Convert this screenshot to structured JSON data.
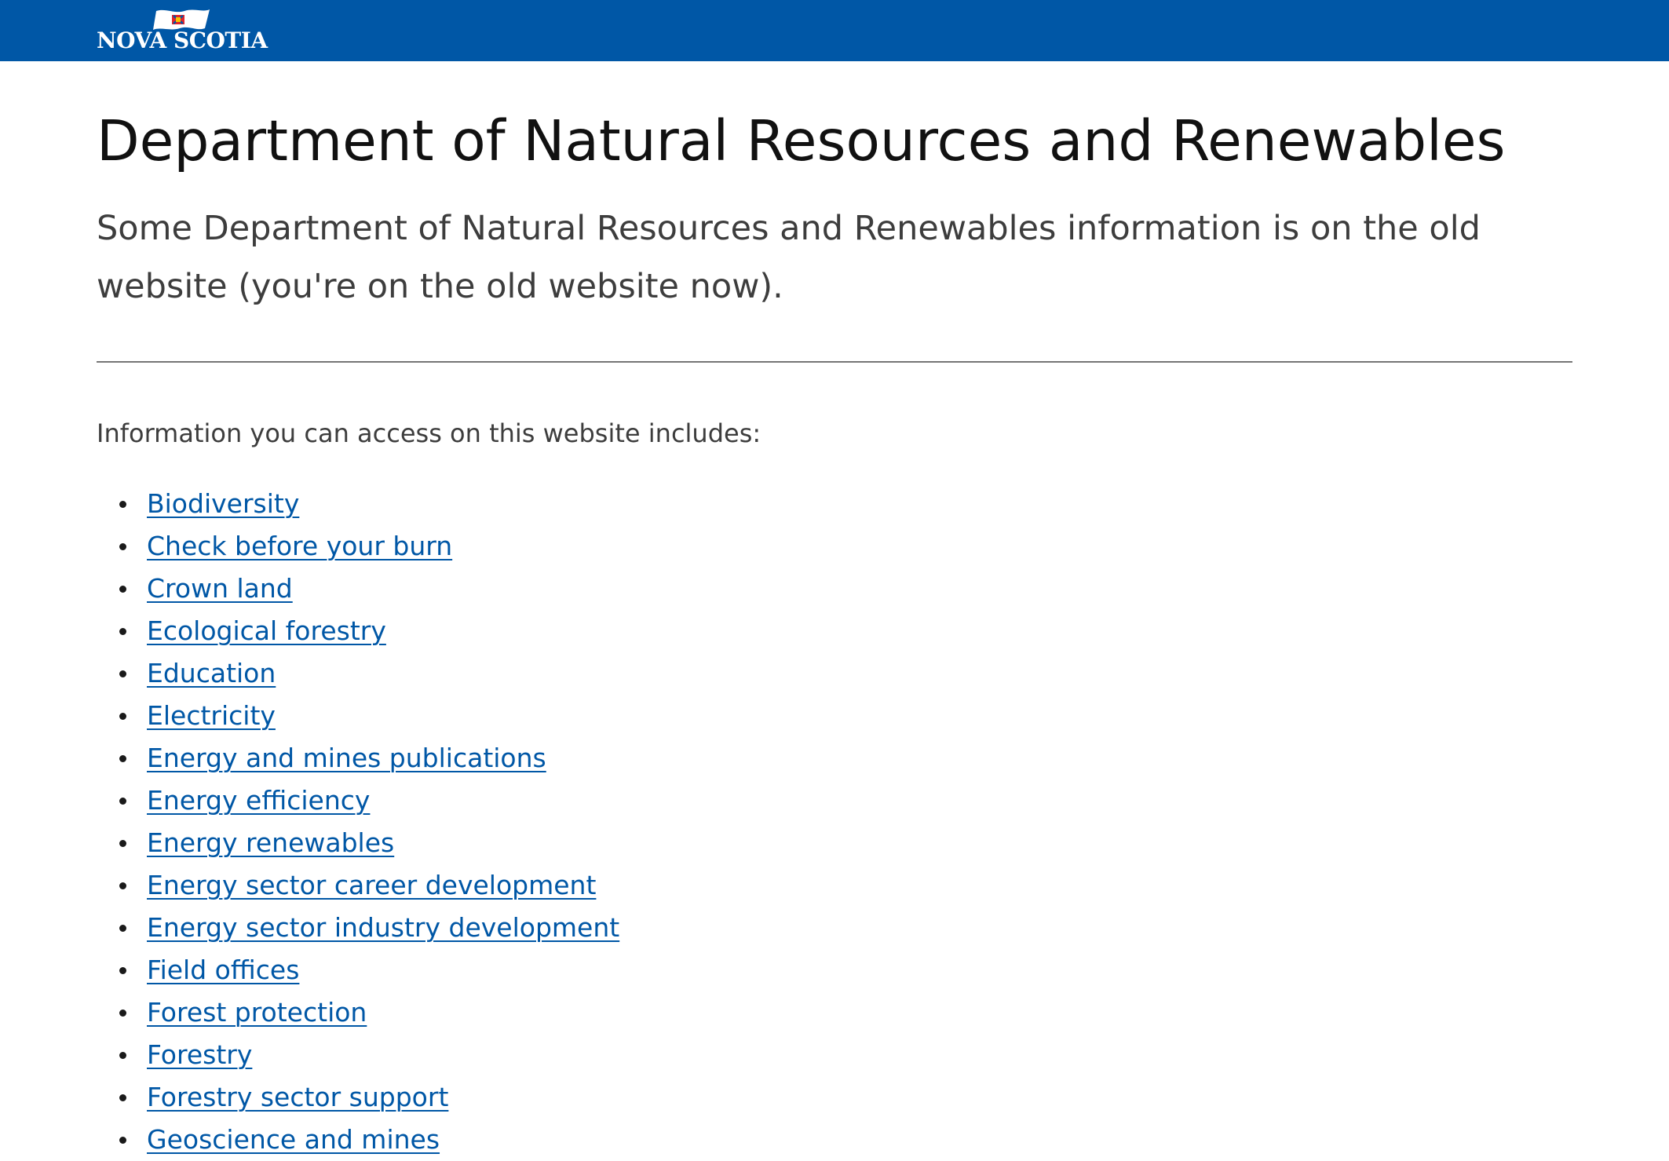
{
  "header": {
    "logo_text": "NOVA SCOTIA",
    "logo_icon": "nova-scotia-flag-icon",
    "background_color": "#0057a6"
  },
  "page": {
    "title": "Department of Natural Resources and Renewables",
    "intro": "Some Department of Natural Resources and Renewables information is on the old website (you're on the old website now).",
    "lead": "Information you can access on this website includes:"
  },
  "links": [
    {
      "label": "Biodiversity"
    },
    {
      "label": "Check before your burn"
    },
    {
      "label": "Crown land"
    },
    {
      "label": "Ecological forestry"
    },
    {
      "label": "Education"
    },
    {
      "label": "Electricity"
    },
    {
      "label": "Energy and mines publications"
    },
    {
      "label": "Energy efficiency"
    },
    {
      "label": "Energy renewables"
    },
    {
      "label": "Energy sector career development"
    },
    {
      "label": "Energy sector industry development"
    },
    {
      "label": "Field offices"
    },
    {
      "label": "Forest protection"
    },
    {
      "label": "Forestry"
    },
    {
      "label": "Forestry sector support"
    },
    {
      "label": "Geoscience and mines"
    }
  ],
  "colors": {
    "link": "#0057a6",
    "text": "#3d3d3d",
    "heading": "#111111"
  }
}
